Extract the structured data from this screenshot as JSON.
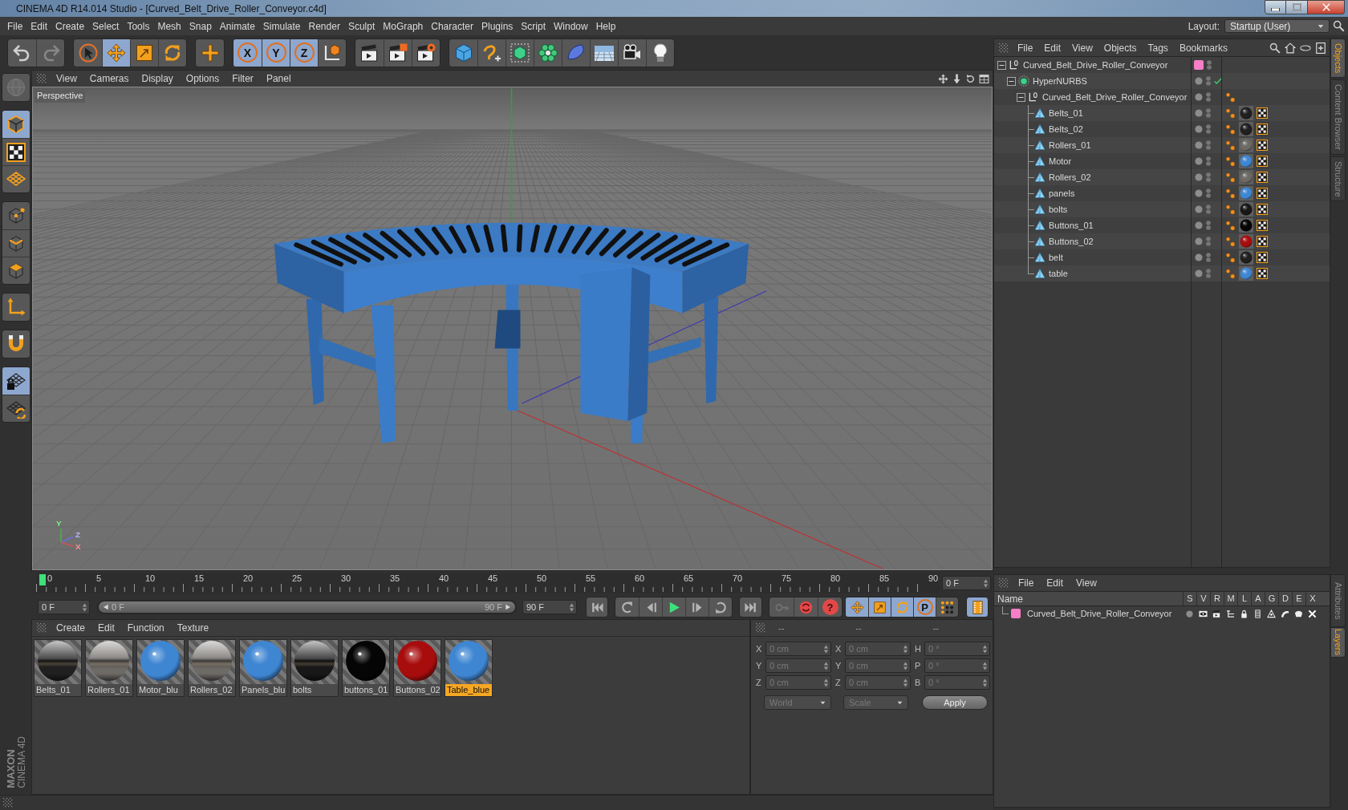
{
  "window": {
    "title": "CINEMA 4D R14.014 Studio - [Curved_Belt_Drive_Roller_Conveyor.c4d]"
  },
  "menu_bar": [
    "File",
    "Edit",
    "Create",
    "Select",
    "Tools",
    "Mesh",
    "Snap",
    "Animate",
    "Simulate",
    "Render",
    "Sculpt",
    "MoGraph",
    "Character",
    "Plugins",
    "Script",
    "Window",
    "Help"
  ],
  "layout": {
    "label": "Layout:",
    "value": "Startup (User)"
  },
  "toolbar": [
    [
      {
        "kind": "undo",
        "selected": false,
        "disabled": false
      },
      {
        "kind": "redo",
        "selected": false,
        "disabled": true
      }
    ],
    [
      {
        "kind": "select",
        "selected": false
      },
      {
        "kind": "move",
        "selected": true
      },
      {
        "kind": "scale",
        "selected": false
      },
      {
        "kind": "rotate",
        "selected": false
      }
    ],
    [
      {
        "kind": "add",
        "selected": false
      }
    ],
    [
      {
        "kind": "axis",
        "label": "X",
        "selected": true
      },
      {
        "kind": "axis",
        "label": "Y",
        "selected": true
      },
      {
        "kind": "axis",
        "label": "Z",
        "selected": true
      },
      {
        "kind": "coords",
        "selected": false
      }
    ],
    [
      {
        "kind": "renderview",
        "selected": false
      },
      {
        "kind": "renderpicture",
        "selected": false
      },
      {
        "kind": "rendersettings",
        "selected": false
      }
    ],
    [
      {
        "kind": "cube",
        "selected": false
      },
      {
        "kind": "spline",
        "selected": false
      },
      {
        "kind": "nurbs",
        "selected": false
      },
      {
        "kind": "array",
        "selected": false
      },
      {
        "kind": "deformer",
        "selected": false
      },
      {
        "kind": "scene",
        "selected": false
      },
      {
        "kind": "camera",
        "selected": false
      },
      {
        "kind": "light",
        "selected": false
      }
    ]
  ],
  "mode_bar": [
    [
      {
        "kind": "convert",
        "selected": false,
        "disabled": true
      }
    ],
    [
      {
        "kind": "model",
        "selected": true
      },
      {
        "kind": "texture",
        "selected": false
      },
      {
        "kind": "workplane",
        "selected": false
      }
    ],
    [
      {
        "kind": "points",
        "selected": false
      },
      {
        "kind": "edges",
        "selected": false
      },
      {
        "kind": "polygons",
        "selected": false
      }
    ],
    [
      {
        "kind": "axismode",
        "selected": false
      }
    ],
    [
      {
        "kind": "magnet",
        "selected": false
      }
    ],
    [
      {
        "kind": "gridlock",
        "selected": true
      },
      {
        "kind": "gridrotate",
        "selected": false
      }
    ]
  ],
  "viewport": {
    "menu": [
      "View",
      "Cameras",
      "Display",
      "Options",
      "Filter",
      "Panel"
    ],
    "camera": "Perspective",
    "axis_labels": [
      "Y",
      "Z",
      "X"
    ]
  },
  "timeline": {
    "ticks": [
      "0",
      "5",
      "10",
      "15",
      "20",
      "25",
      "30",
      "35",
      "40",
      "45",
      "50",
      "55",
      "60",
      "65",
      "70",
      "75",
      "80",
      "85",
      "90"
    ],
    "level": 0,
    "frame": "0 F"
  },
  "playback": {
    "start": "0 F",
    "range_start": "0 F",
    "range_end": "90 F",
    "range_bar": {
      "level": 1
    },
    "end": "90 F",
    "record_tools": [
      {
        "kind": "autokey",
        "disabled": true
      },
      {
        "kind": "record",
        "disabled": false
      },
      {
        "kind": "help",
        "label": "?",
        "disabled": false
      }
    ],
    "key_tools": [
      {
        "kind": "move",
        "selected": true
      },
      {
        "kind": "scale",
        "selected": true
      },
      {
        "kind": "rotate",
        "selected": true
      },
      {
        "kind": "parameter",
        "label": "P",
        "selected": true
      },
      {
        "kind": "pla",
        "selected": false
      }
    ],
    "timeline_button": {
      "selected": true
    }
  },
  "materials": {
    "menu": [
      "Create",
      "Edit",
      "Function",
      "Texture"
    ],
    "items": [
      {
        "name": "Belts_01",
        "kind": "chrome",
        "color": "#202020",
        "selected": false
      },
      {
        "name": "Rollers_01",
        "kind": "chrome",
        "color": "#6e6a66",
        "selected": false
      },
      {
        "name": "Motor_blu",
        "kind": "glossy",
        "color": "#3f86d2",
        "selected": false
      },
      {
        "name": "Rollers_02",
        "kind": "chrome",
        "color": "#6e6a66",
        "selected": false
      },
      {
        "name": "Panels_blu",
        "kind": "glossy",
        "color": "#3f86d2",
        "selected": false
      },
      {
        "name": "bolts",
        "kind": "chrome",
        "color": "#181818",
        "selected": false
      },
      {
        "name": "buttons_01",
        "kind": "glossy",
        "color": "#050505",
        "selected": false
      },
      {
        "name": "Buttons_02",
        "kind": "glossy",
        "color": "#a80d0d",
        "selected": false
      },
      {
        "name": "Table_blue",
        "kind": "glossy",
        "color": "#3f86d2",
        "selected": true
      }
    ]
  },
  "coordinates": {
    "headers": [
      "--",
      "--",
      "--"
    ],
    "disabled": true,
    "rows": [
      [
        {
          "axis": "X",
          "value": "0 cm"
        },
        {
          "axis": "X",
          "value": "0 cm"
        },
        {
          "axis": "H",
          "value": "0 °"
        }
      ],
      [
        {
          "axis": "Y",
          "value": "0 cm"
        },
        {
          "axis": "Y",
          "value": "0 cm"
        },
        {
          "axis": "P",
          "value": "0 °"
        }
      ],
      [
        {
          "axis": "Z",
          "value": "0 cm"
        },
        {
          "axis": "Z",
          "value": "0 cm"
        },
        {
          "axis": "B",
          "value": "0 °"
        }
      ]
    ],
    "space": "World",
    "mode": "Scale",
    "apply": "Apply"
  },
  "objects": {
    "menu": [
      "File",
      "Edit",
      "View",
      "Objects",
      "Tags",
      "Bookmarks"
    ],
    "tree": [
      {
        "name": "Curved_Belt_Drive_Roller_Conveyor",
        "kind": "null",
        "expanded": true,
        "color": "#f57ec6",
        "children": [
          {
            "name": "HyperNURBS",
            "kind": "nurbs",
            "expanded": true,
            "enabled": true,
            "children": [
              {
                "name": "Curved_Belt_Drive_Roller_Conveyor",
                "kind": "null",
                "expanded": true,
                "tags": [
                  {
                    "kind": "phong"
                  }
                ],
                "children": [
                  {
                    "name": "Belts_01",
                    "kind": "polygon",
                    "tags": [
                      {
                        "kind": "phong"
                      },
                      {
                        "kind": "material",
                        "color": "#202020"
                      },
                      {
                        "kind": "uvw"
                      }
                    ]
                  },
                  {
                    "name": "Belts_02",
                    "kind": "polygon",
                    "tags": [
                      {
                        "kind": "phong"
                      },
                      {
                        "kind": "material",
                        "color": "#202020"
                      },
                      {
                        "kind": "uvw"
                      }
                    ]
                  },
                  {
                    "name": "Rollers_01",
                    "kind": "polygon",
                    "tags": [
                      {
                        "kind": "phong"
                      },
                      {
                        "kind": "material",
                        "color": "#6e6a66"
                      },
                      {
                        "kind": "uvw"
                      }
                    ]
                  },
                  {
                    "name": "Motor",
                    "kind": "polygon",
                    "tags": [
                      {
                        "kind": "phong"
                      },
                      {
                        "kind": "material",
                        "color": "#3f86d2"
                      },
                      {
                        "kind": "uvw"
                      }
                    ]
                  },
                  {
                    "name": "Rollers_02",
                    "kind": "polygon",
                    "tags": [
                      {
                        "kind": "phong"
                      },
                      {
                        "kind": "material",
                        "color": "#6e6a66"
                      },
                      {
                        "kind": "uvw"
                      }
                    ]
                  },
                  {
                    "name": "panels",
                    "kind": "polygon",
                    "tags": [
                      {
                        "kind": "phong"
                      },
                      {
                        "kind": "material",
                        "color": "#3f86d2"
                      },
                      {
                        "kind": "uvw"
                      }
                    ]
                  },
                  {
                    "name": "bolts",
                    "kind": "polygon",
                    "tags": [
                      {
                        "kind": "phong"
                      },
                      {
                        "kind": "material",
                        "color": "#181818"
                      },
                      {
                        "kind": "uvw"
                      }
                    ]
                  },
                  {
                    "name": "Buttons_01",
                    "kind": "polygon",
                    "tags": [
                      {
                        "kind": "phong"
                      },
                      {
                        "kind": "material",
                        "color": "#050505"
                      },
                      {
                        "kind": "uvw"
                      }
                    ]
                  },
                  {
                    "name": "Buttons_02",
                    "kind": "polygon",
                    "tags": [
                      {
                        "kind": "phong"
                      },
                      {
                        "kind": "material",
                        "color": "#a80d0d"
                      },
                      {
                        "kind": "uvw"
                      }
                    ]
                  },
                  {
                    "name": "belt",
                    "kind": "polygon",
                    "tags": [
                      {
                        "kind": "phong"
                      },
                      {
                        "kind": "material",
                        "color": "#202020"
                      },
                      {
                        "kind": "uvw"
                      }
                    ]
                  },
                  {
                    "name": "table",
                    "kind": "polygon",
                    "tags": [
                      {
                        "kind": "phong"
                      },
                      {
                        "kind": "material",
                        "color": "#3f86d2"
                      },
                      {
                        "kind": "uvw"
                      }
                    ]
                  }
                ]
              }
            ]
          }
        ]
      }
    ]
  },
  "layers": {
    "menu": [
      "File",
      "Edit",
      "View"
    ],
    "columns": [
      "Name",
      "S",
      "V",
      "R",
      "M",
      "L",
      "A",
      "G",
      "D",
      "E",
      "X"
    ],
    "rows": [
      {
        "name": "Curved_Belt_Drive_Roller_Conveyor",
        "color": "#f57ec6"
      }
    ]
  },
  "side_tabs": {
    "top": [
      {
        "label": "Objects",
        "selected": true
      },
      {
        "label": "Content Browser",
        "selected": false
      },
      {
        "label": "Structure",
        "selected": false
      }
    ],
    "bottom": [
      {
        "label": "Attributes",
        "selected": false
      },
      {
        "label": "Layers",
        "selected": true
      }
    ]
  },
  "logo": {
    "brand": "MAXON",
    "product": "CINEMA 4D"
  }
}
